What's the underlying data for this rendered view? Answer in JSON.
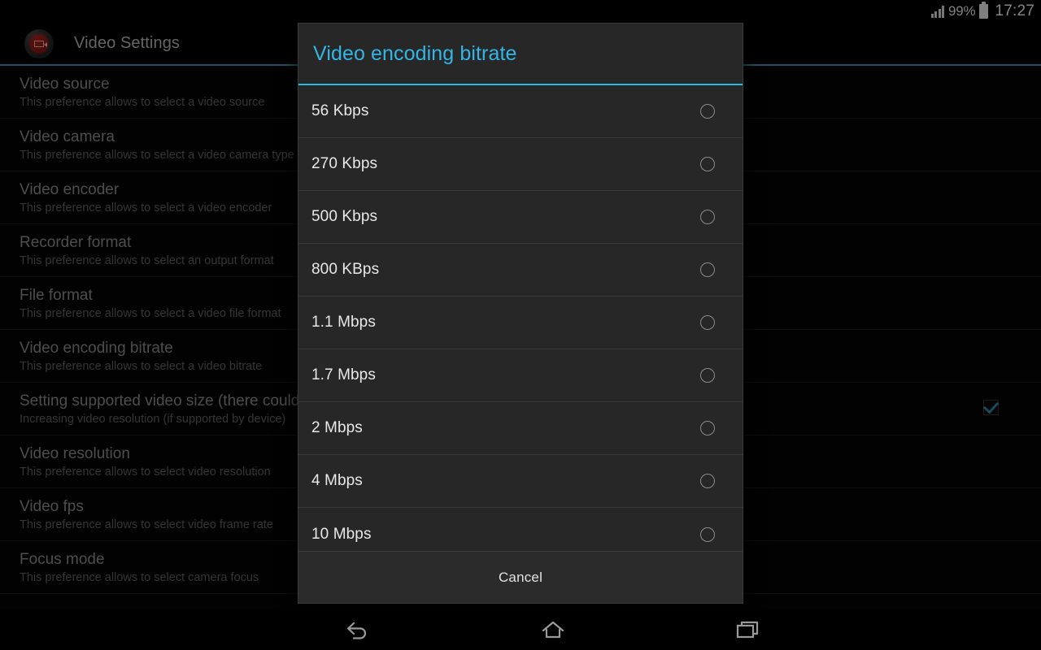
{
  "status_bar": {
    "signal_icon": "signal-bars-icon",
    "battery_percent": "99%",
    "battery_icon": "battery-full-icon",
    "clock": "17:27"
  },
  "action_bar": {
    "app_icon": "video-recorder-app-icon",
    "title": "Video Settings",
    "accent_color": "#33b5e5"
  },
  "preferences": [
    {
      "title": "Video source",
      "summary": "This preference allows to select a video source",
      "checkbox": false
    },
    {
      "title": "Video camera",
      "summary": "This preference allows to select a video camera type",
      "checkbox": false
    },
    {
      "title": "Video encoder",
      "summary": "This preference allows to select a video encoder",
      "checkbox": false
    },
    {
      "title": "Recorder format",
      "summary": "This preference allows to select an output format",
      "checkbox": false
    },
    {
      "title": "File format",
      "summary": "This preference allows to select a video file format",
      "checkbox": false
    },
    {
      "title": "Video encoding bitrate",
      "summary": "This preference allows to select a video bitrate",
      "checkbox": false
    },
    {
      "title": "Setting supported video size (there could be",
      "summary": "Increasing video resolution (if supported by device)",
      "checkbox": true
    },
    {
      "title": "Video resolution",
      "summary": "This preference allows to select video resolution",
      "checkbox": false
    },
    {
      "title": "Video fps",
      "summary": "This preference allows to select video frame rate",
      "checkbox": false
    },
    {
      "title": "Focus mode",
      "summary": "This preference allows to select camera focus",
      "checkbox": false
    }
  ],
  "dialog": {
    "title": "Video encoding bitrate",
    "title_color": "#33b5e5",
    "options": [
      {
        "label": "56 Kbps",
        "selected": false
      },
      {
        "label": "270 Kbps",
        "selected": false
      },
      {
        "label": "500 Kbps",
        "selected": false
      },
      {
        "label": "800 KBps",
        "selected": false
      },
      {
        "label": "1.1 Mbps",
        "selected": false
      },
      {
        "label": "1.7 Mbps",
        "selected": false
      },
      {
        "label": "2 Mbps",
        "selected": false
      },
      {
        "label": "4 Mbps",
        "selected": false
      },
      {
        "label": "10 Mbps",
        "selected": false
      }
    ],
    "cancel_label": "Cancel"
  },
  "nav_bar": {
    "back_icon": "back-arrow-icon",
    "home_icon": "home-icon",
    "recents_icon": "recent-apps-icon"
  }
}
